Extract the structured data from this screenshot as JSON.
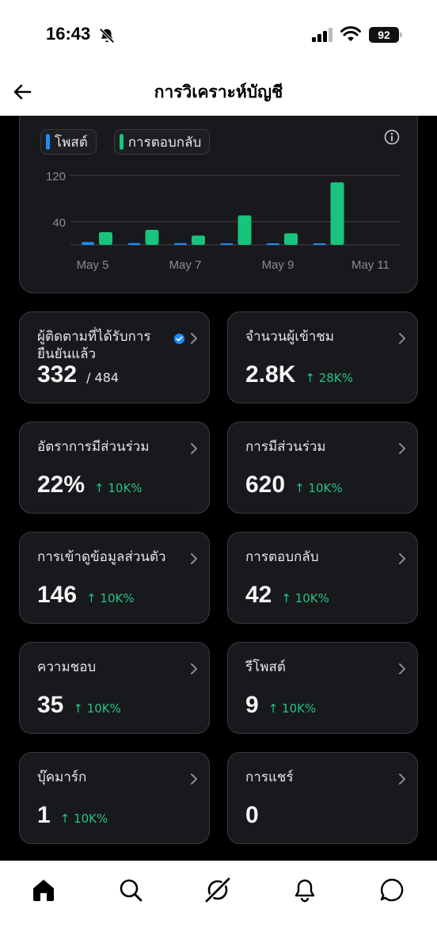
{
  "status": {
    "time": "16:43",
    "battery": "92"
  },
  "header": {
    "title": "การวิเคราะห์บัญชี"
  },
  "chart": {
    "legend": [
      {
        "label": "โพสต์",
        "color": "#1d8cf8"
      },
      {
        "label": "การตอบกลับ",
        "color": "#19c37d"
      }
    ]
  },
  "chart_data": {
    "type": "bar",
    "categories": [
      "May 5",
      "May 6",
      "May 7",
      "May 8",
      "May 9",
      "May 10"
    ],
    "x_tick_labels": [
      "May 5",
      "May 7",
      "May 9",
      "May 11"
    ],
    "y_ticks": [
      "120",
      "40"
    ],
    "ylim": [
      0,
      130
    ],
    "grid": true,
    "series": [
      {
        "name": "โพสต์",
        "color": "#1d8cf8",
        "values": [
          5,
          3,
          3,
          2,
          1,
          2
        ]
      },
      {
        "name": "การตอบกลับ",
        "color": "#19c37d",
        "values": [
          22,
          26,
          16,
          51,
          20,
          108
        ]
      }
    ]
  },
  "stats": [
    {
      "label": "ผู้ติดตามที่ได้รับการยืนยันแล้ว",
      "value": "332",
      "sub": "/ 484",
      "change": "",
      "verified": true
    },
    {
      "label": "จำนวนผู้เข้าชม",
      "value": "2.8K",
      "sub": "",
      "change": "↑ 28K%"
    },
    {
      "label": "อัตราการมีส่วนร่วม",
      "value": "22%",
      "sub": "",
      "change": "↑ 10K%"
    },
    {
      "label": "การมีส่วนร่วม",
      "value": "620",
      "sub": "",
      "change": "↑ 10K%"
    },
    {
      "label": "การเข้าดูข้อมูลส่วนตัว",
      "value": "146",
      "sub": "",
      "change": "↑ 10K%"
    },
    {
      "label": "การตอบกลับ",
      "value": "42",
      "sub": "",
      "change": "↑ 10K%"
    },
    {
      "label": "ความชอบ",
      "value": "35",
      "sub": "",
      "change": "↑ 10K%"
    },
    {
      "label": "รีโพสต์",
      "value": "9",
      "sub": "",
      "change": "↑ 10K%"
    },
    {
      "label": "บุ๊คมาร์ก",
      "value": "1",
      "sub": "",
      "change": "↑ 10K%"
    },
    {
      "label": "การแชร์",
      "value": "0",
      "sub": "",
      "change": ""
    }
  ],
  "bottom_nav": [
    "home-icon",
    "search-icon",
    "grok-icon",
    "notifications-icon",
    "messages-icon"
  ]
}
